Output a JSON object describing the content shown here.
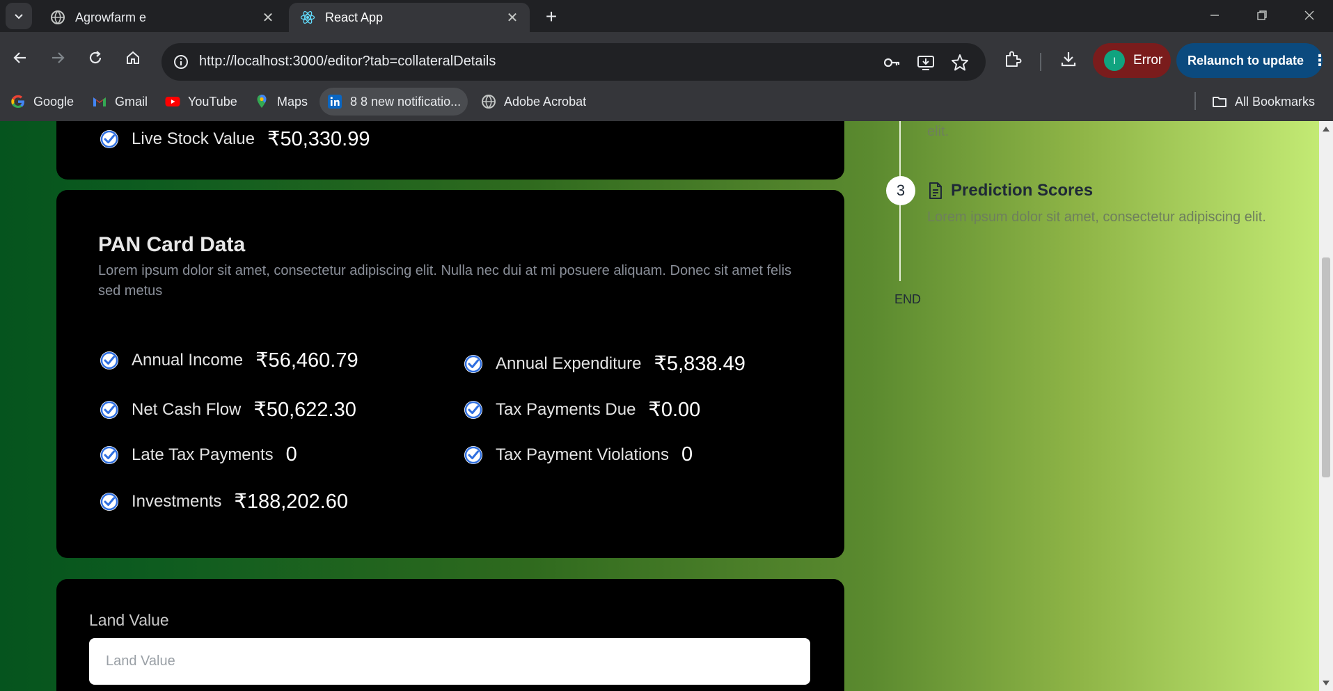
{
  "browser": {
    "tabs": [
      {
        "title": "Agrowfarm e",
        "favicon": "globe-icon"
      },
      {
        "title": "React App",
        "favicon": "react-icon"
      }
    ],
    "address": "http://localhost:3000/editor?tab=collateralDetails",
    "profile_initial": "I",
    "error_label": "Error",
    "relaunch_label": "Relaunch to update"
  },
  "bookmarks": {
    "items": [
      {
        "label": "Google",
        "icon": "google-icon"
      },
      {
        "label": "Gmail",
        "icon": "gmail-icon"
      },
      {
        "label": "YouTube",
        "icon": "youtube-icon"
      },
      {
        "label": "Maps",
        "icon": "maps-icon"
      },
      {
        "label": "8 8 new notificatio...",
        "icon": "linkedin-icon"
      },
      {
        "label": "Adobe Acrobat",
        "icon": "globe-icon"
      }
    ],
    "all_label": "All Bookmarks"
  },
  "livestock": {
    "label": "Live Stock Value",
    "value": "₹50,330.99"
  },
  "pan": {
    "title": "PAN Card Data",
    "description": "Lorem ipsum dolor sit amet, consectetur adipiscing elit. Nulla nec dui at mi posuere aliquam. Donec sit amet felis sed metus",
    "fields": [
      {
        "label": "Annual Income",
        "value": "₹56,460.79"
      },
      {
        "label": "Annual Expenditure",
        "value": "₹5,838.49"
      },
      {
        "label": "Net Cash Flow",
        "value": "₹50,622.30"
      },
      {
        "label": "Tax Payments Due",
        "value": "₹0.00"
      },
      {
        "label": "Late Tax Payments",
        "value": "0"
      },
      {
        "label": "Tax Payment Violations",
        "value": "0"
      },
      {
        "label": "Investments",
        "value": "₹188,202.60"
      }
    ]
  },
  "land": {
    "label": "Land Value",
    "placeholder": "Land Value"
  },
  "timeline": {
    "prev_tail": "elit.",
    "step": {
      "number": "3",
      "title": "Prediction Scores",
      "description": "Lorem ipsum dolor sit amet, consectetur adipiscing elit."
    },
    "end_label": "END"
  },
  "colors": {
    "accent_check": "#2f6fe0",
    "card_bg": "#000000",
    "error_pill": "#7a1c1c",
    "relaunch_pill": "#0b4a7e"
  }
}
